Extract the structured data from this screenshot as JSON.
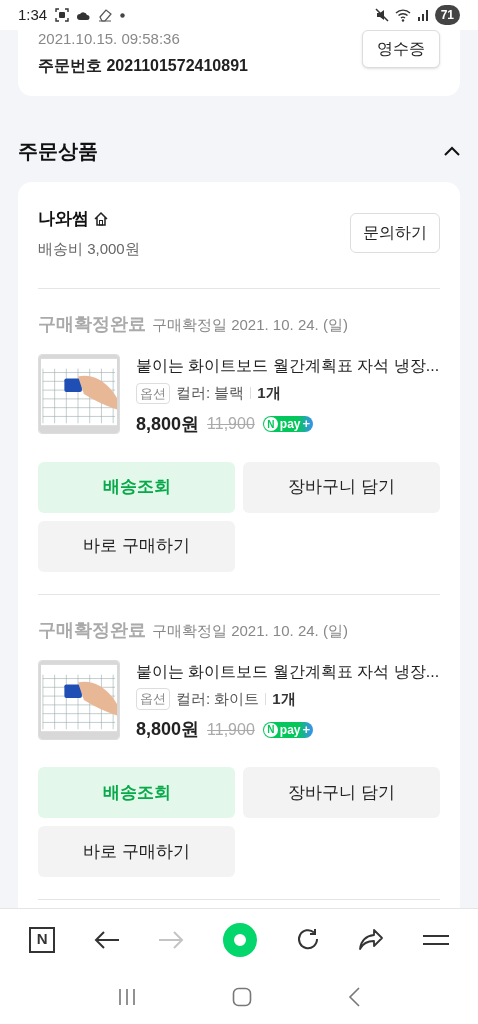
{
  "status_bar": {
    "time": "1:34",
    "battery": "71"
  },
  "order": {
    "datetime": "2021.10.15. 09:58:36",
    "order_number": "주문번호 2021101572410891",
    "receipt_button": "영수증"
  },
  "section": {
    "title": "주문상품",
    "expanded": true
  },
  "seller": {
    "name": "나와썸",
    "shipping": "배송비 3,000원",
    "inquiry_button": "문의하기"
  },
  "items": [
    {
      "status": "구매확정완료",
      "confirm_date": "구매확정일 2021. 10. 24. (일)",
      "title": "붙이는 화이트보드 월간계획표 자석 냉장...",
      "option_label": "옵션",
      "option": "컬러: 블랙",
      "quantity": "1개",
      "price": "8,800원",
      "original_price": "11,900",
      "npay": [
        "N",
        "pay",
        "+"
      ],
      "buttons": [
        {
          "label": "배송조회",
          "kind": "primary"
        },
        {
          "label": "장바구니 담기",
          "kind": "secondary"
        },
        {
          "label": "바로 구매하기",
          "kind": "secondary"
        }
      ]
    },
    {
      "status": "구매확정완료",
      "confirm_date": "구매확정일 2021. 10. 24. (일)",
      "title": "붙이는 화이트보드 월간계획표 자석 냉장...",
      "option_label": "옵션",
      "option": "컬러: 화이트",
      "quantity": "1개",
      "price": "8,800원",
      "original_price": "11,900",
      "npay": [
        "N",
        "pay",
        "+"
      ],
      "buttons": [
        {
          "label": "배송조회",
          "kind": "primary"
        },
        {
          "label": "장바구니 담기",
          "kind": "secondary"
        },
        {
          "label": "바로 구매하기",
          "kind": "secondary"
        }
      ]
    }
  ],
  "toolbar": {
    "logo": "N",
    "forward_disabled": true
  }
}
